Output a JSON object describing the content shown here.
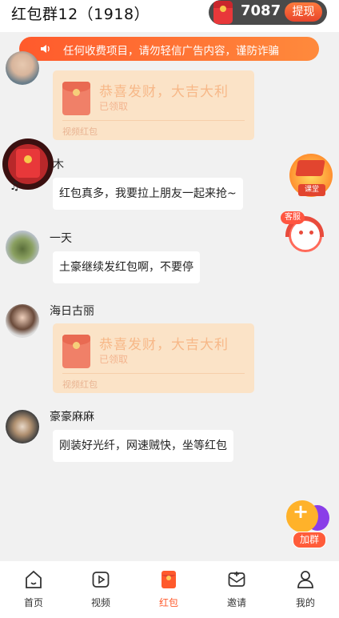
{
  "header": {
    "title": "红包群12（1918）",
    "coins": "7087",
    "withdraw_label": "提现"
  },
  "notice": {
    "text": "任何收费项目，请勿轻信广告内容，谨防诈骗"
  },
  "messages": [
    {
      "name": "",
      "type": "redpacket",
      "greeting": "恭喜发财，大吉大利",
      "status": "已领取",
      "footer": "视频红包"
    },
    {
      "name": "木",
      "type": "text",
      "text": "红包真多，我要拉上朋友一起来抢~"
    },
    {
      "name": "一天",
      "type": "text",
      "text": "土豪继续发红包啊，不要停"
    },
    {
      "name": "海日古丽",
      "type": "redpacket",
      "greeting": "恭喜发财，大吉大利",
      "status": "已领取",
      "footer": "视频红包"
    },
    {
      "name": "豪豪麻麻",
      "type": "text",
      "text": "刚装好光纤，网速贼快，坐等红包"
    }
  ],
  "floating": {
    "course_label": "课堂",
    "service_label": "客服",
    "join_label": "加群"
  },
  "tabs": [
    {
      "label": "首页",
      "icon": "home-icon"
    },
    {
      "label": "视频",
      "icon": "video-icon"
    },
    {
      "label": "红包",
      "icon": "redpacket-icon",
      "active": true
    },
    {
      "label": "邀请",
      "icon": "invite-icon"
    },
    {
      "label": "我的",
      "icon": "profile-icon"
    }
  ],
  "colors": {
    "accent": "#ff5a2c",
    "active_tab": "#ff5a2c",
    "card_bg": "#fbe3c7"
  }
}
